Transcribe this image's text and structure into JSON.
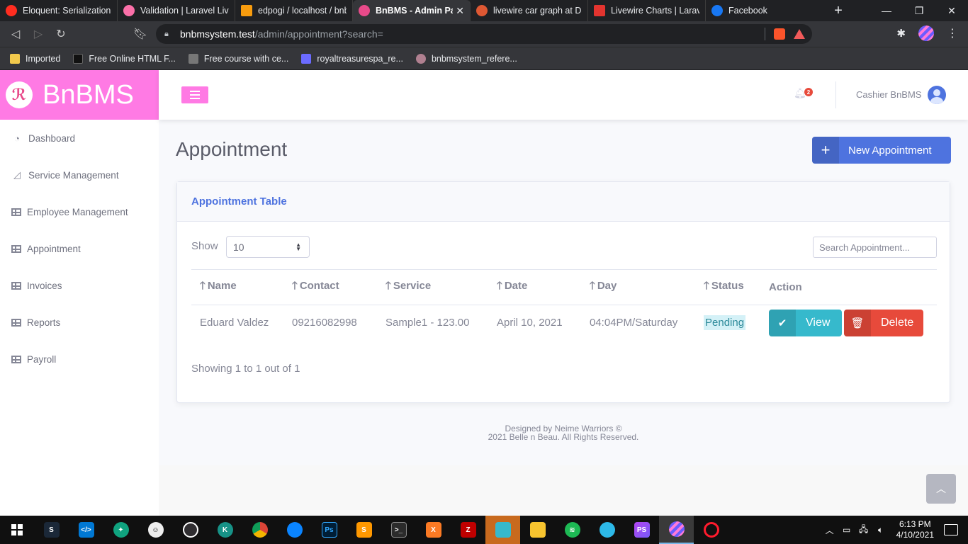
{
  "browser": {
    "tabs": [
      {
        "title": "Eloquent: Serialization -",
        "icon_color": "#ff2d20",
        "icon": "laravel-icon",
        "active": false
      },
      {
        "title": "Validation | Laravel Livew",
        "icon_color": "#fb70a9",
        "icon": "livewire-icon",
        "active": false
      },
      {
        "title": "edpogi / localhost / bnbm",
        "icon_color": "#f89c0e",
        "icon": "phpmyadmin-icon",
        "active": false
      },
      {
        "title": "BnBMS - Admin Panel",
        "icon_color": "#e84a8a",
        "icon": "bnbms-icon",
        "active": true
      },
      {
        "title": "livewire car graph at Duck",
        "icon_color": "#de5833",
        "icon": "duckduckgo-icon",
        "active": false
      },
      {
        "title": "Livewire Charts | Laravel",
        "icon_color": "#e3342f",
        "icon": "livewire-charts-icon",
        "active": false
      },
      {
        "title": "Facebook",
        "icon_color": "#1877f2",
        "icon": "facebook-icon",
        "active": false
      }
    ],
    "url_host": "bnbmsystem.test",
    "url_path": "/admin/appointment?search=",
    "bookmarks": [
      {
        "label": "Imported",
        "icon": "folder-icon",
        "color": "#f2c94c"
      },
      {
        "label": "Free Online HTML F...",
        "icon": "ff-icon",
        "color": "#111111"
      },
      {
        "label": "Free course with ce...",
        "icon": "course-icon",
        "color": "#777777"
      },
      {
        "label": "royaltreasurespa_re...",
        "icon": "royal-icon",
        "color": "#6b6bff"
      },
      {
        "label": "bnbmsystem_refere...",
        "icon": "bnbms-ref-icon",
        "color": "#b08090"
      }
    ]
  },
  "sidebar": {
    "brand": "BnBMS",
    "items": [
      {
        "label": "Dashboard",
        "icon": "dashboard-icon"
      },
      {
        "label": "Service Management",
        "icon": "chart-area-icon"
      },
      {
        "label": "Employee Management",
        "icon": "table-icon"
      },
      {
        "label": "Appointment",
        "icon": "table-icon"
      },
      {
        "label": "Invoices",
        "icon": "table-icon"
      },
      {
        "label": "Reports",
        "icon": "table-icon"
      },
      {
        "label": "Payroll",
        "icon": "table-icon"
      }
    ]
  },
  "topbar": {
    "notification_count": "2",
    "user_name": "Cashier BnBMS"
  },
  "main": {
    "heading": "Appointment",
    "new_button": "New Appointment",
    "card_title": "Appointment Table",
    "show_label": "Show",
    "page_size": "10",
    "search_placeholder": "Search Appointment...",
    "columns": [
      "Name",
      "Contact",
      "Service",
      "Date",
      "Day",
      "Status",
      "Action"
    ],
    "rows": [
      {
        "name": "Eduard Valdez",
        "contact": "09216082998",
        "service": "Sample1 - 123.00",
        "date": "April 10, 2021",
        "day": "04:04PM/Saturday",
        "status": "Pending"
      }
    ],
    "view_label": "View",
    "delete_label": "Delete",
    "showing_text": "Showing 1 to 1 out of 1"
  },
  "footer": {
    "line1": "Designed by Neime Warriors ©",
    "line2": "2021 Belle n Beau. All Rights Reserved."
  },
  "taskbar": {
    "apps": [
      "steam-icon",
      "vscode-icon",
      "chatgpt-icon",
      "face-icon",
      "obs-icon",
      "gitkraken-icon",
      "chrome-icon",
      "firefox-icon",
      "photoshop-icon",
      "sublime-icon",
      "terminal-icon",
      "xampp-icon",
      "filezilla-icon",
      "app-icon",
      "file-explorer-icon",
      "spotify-icon",
      "edge-icon",
      "phpstorm-icon",
      "brave-icon",
      "opera-icon"
    ],
    "time": "6:13 PM",
    "date": "4/10/2021"
  }
}
